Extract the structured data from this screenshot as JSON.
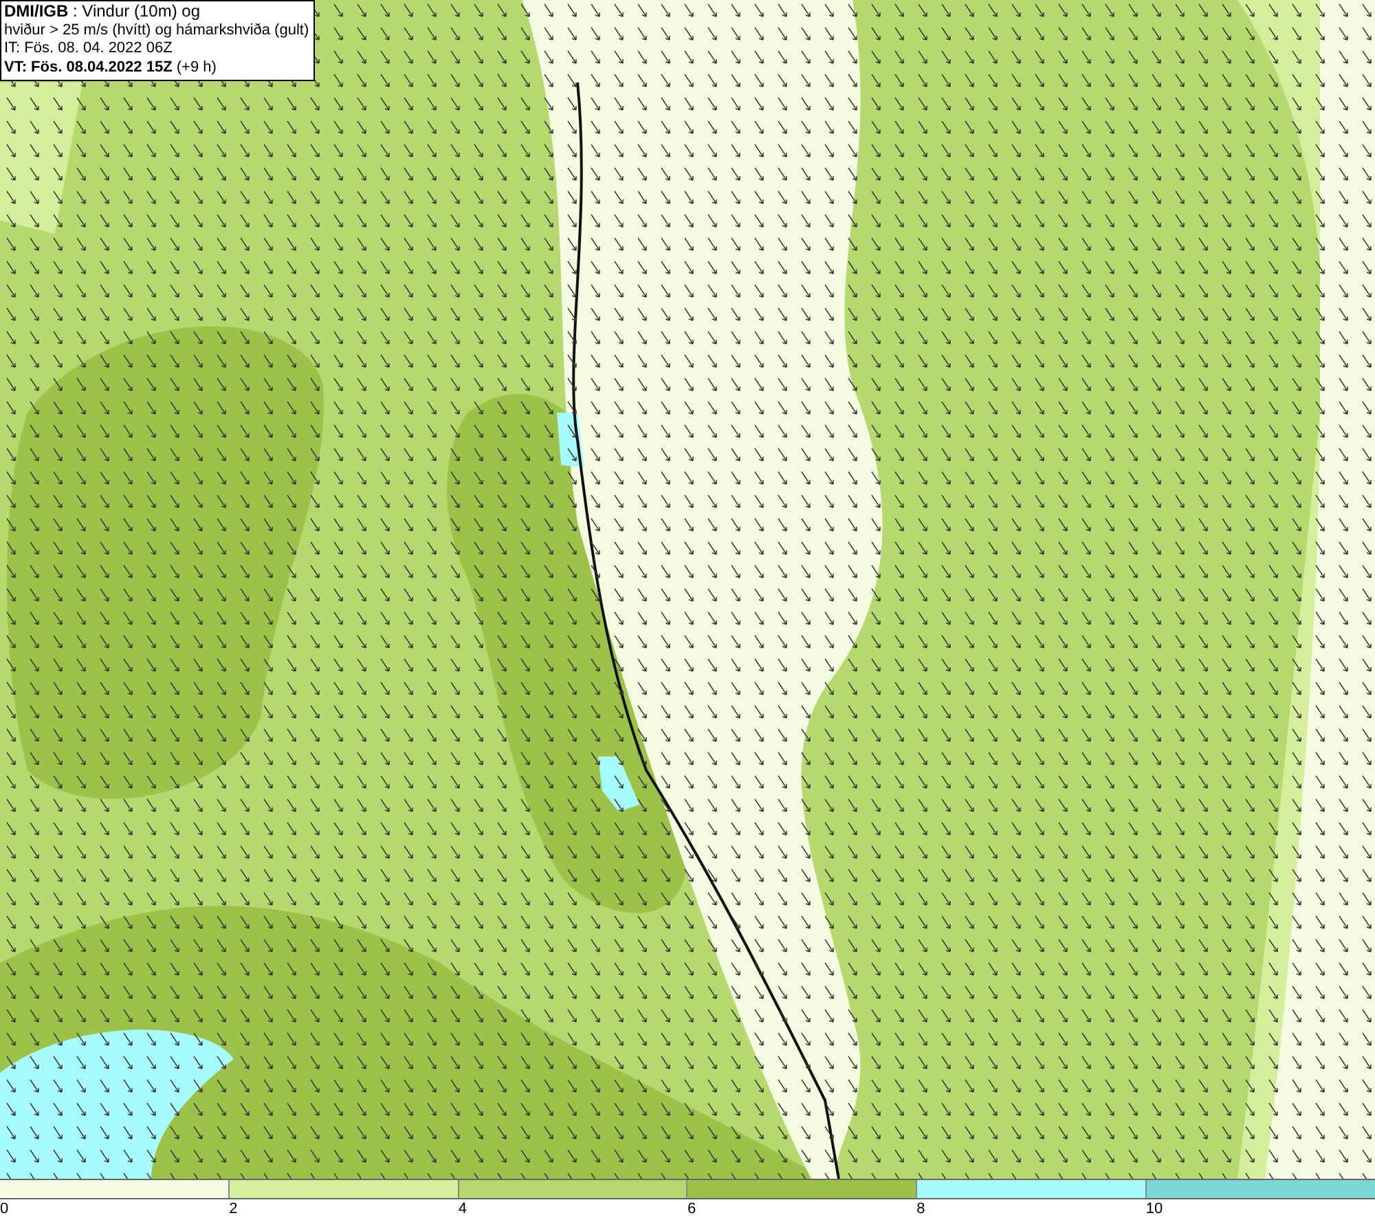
{
  "info_box": {
    "lines": [
      "**DMI/IGB** : Vindur (10m) og",
      "hviður > 25 m/s (hvítt) og hámarkshviða (gult)",
      "IT: Fös. 08. 04. 2022 06Z",
      "**VT: Fös. 08.04.2022 15Z** (+9 h)"
    ]
  },
  "legend": {
    "segments": [
      {
        "color": "#f5fbe0"
      },
      {
        "color": "#d5ee9c"
      },
      {
        "color": "#b5d96f"
      },
      {
        "color": "#9cc24a"
      },
      {
        "color": "#a8fbfd"
      },
      {
        "color": "#7fd6d6"
      }
    ],
    "ticks": [
      "0",
      "2",
      "4",
      "6",
      "8",
      "10"
    ]
  }
}
